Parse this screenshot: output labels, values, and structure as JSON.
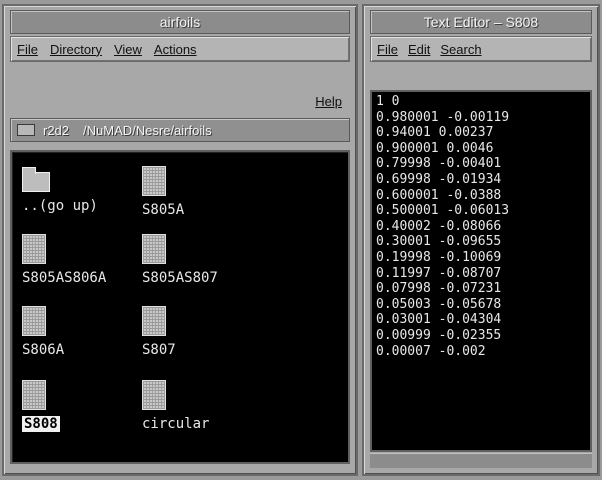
{
  "file_manager": {
    "title": "airfoils",
    "menu": [
      "File",
      "Directory",
      "View",
      "Actions"
    ],
    "help": "Help",
    "path": [
      "r2d2",
      "/NuMAD/Nesre/airfoils"
    ],
    "icons": [
      {
        "label": "..(go up)",
        "type": "folder",
        "selected": false
      },
      {
        "label": "S805A",
        "type": "file",
        "selected": false
      },
      {
        "label": "S805AS806A",
        "type": "file",
        "selected": false
      },
      {
        "label": "S805AS807",
        "type": "file",
        "selected": false
      },
      {
        "label": "S806A",
        "type": "file",
        "selected": false
      },
      {
        "label": "S807",
        "type": "file",
        "selected": false
      },
      {
        "label": "S808",
        "type": "file",
        "selected": true
      },
      {
        "label": "circular",
        "type": "file",
        "selected": false
      }
    ]
  },
  "text_editor": {
    "title": "Text Editor – S808",
    "menu": [
      "File",
      "Edit",
      "Search"
    ],
    "lines": [
      "1 0",
      "0.980001 -0.00119",
      "0.94001 0.00237",
      "0.900001 0.0046",
      "0.79998 -0.00401",
      "0.69998 -0.01934",
      "0.600001 -0.0388",
      "0.500001 -0.06013",
      "0.40002 -0.08066",
      "0.30001 -0.09655",
      "0.19998 -0.10069",
      "0.11997 -0.08707",
      "0.07998 -0.07231",
      "0.05003 -0.05678",
      "0.03001 -0.04304",
      "0.00999 -0.02355",
      "0.00007 -0.002"
    ]
  }
}
